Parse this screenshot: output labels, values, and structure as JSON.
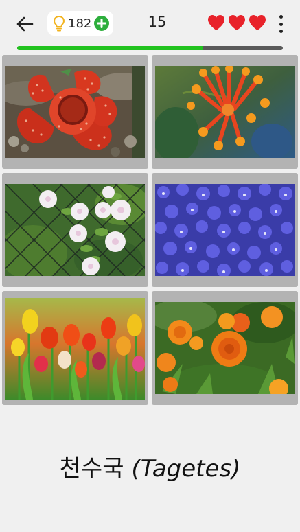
{
  "header": {
    "back_icon": "arrow-left-icon",
    "hint_icon": "lightbulb-icon",
    "hint_count": "182",
    "add_hint_icon": "plus-circle-icon",
    "level": "15",
    "lives": [
      "heart-icon",
      "heart-icon",
      "heart-icon"
    ],
    "menu_icon": "more-vert-icon"
  },
  "progress": {
    "value": 0.7
  },
  "colors": {
    "accent_green": "#2dae3c",
    "progress_green": "#22c31f",
    "heart_red": "#e8222a"
  },
  "options": [
    {
      "id": "rafflesia",
      "image": "red rafflesia flower"
    },
    {
      "id": "honeysuckle",
      "image": "orange honeysuckle flowers"
    },
    {
      "id": "morning-glory",
      "image": "white morning glory on wire fence"
    },
    {
      "id": "lobelia",
      "image": "purple-blue lobelia flowers"
    },
    {
      "id": "tulips",
      "image": "field of colorful tulips"
    },
    {
      "id": "marigold",
      "image": "orange marigolds"
    }
  ],
  "question": {
    "korean": "천수국",
    "latin_open": "(",
    "latin": "Tagetes",
    "latin_close": ")"
  }
}
